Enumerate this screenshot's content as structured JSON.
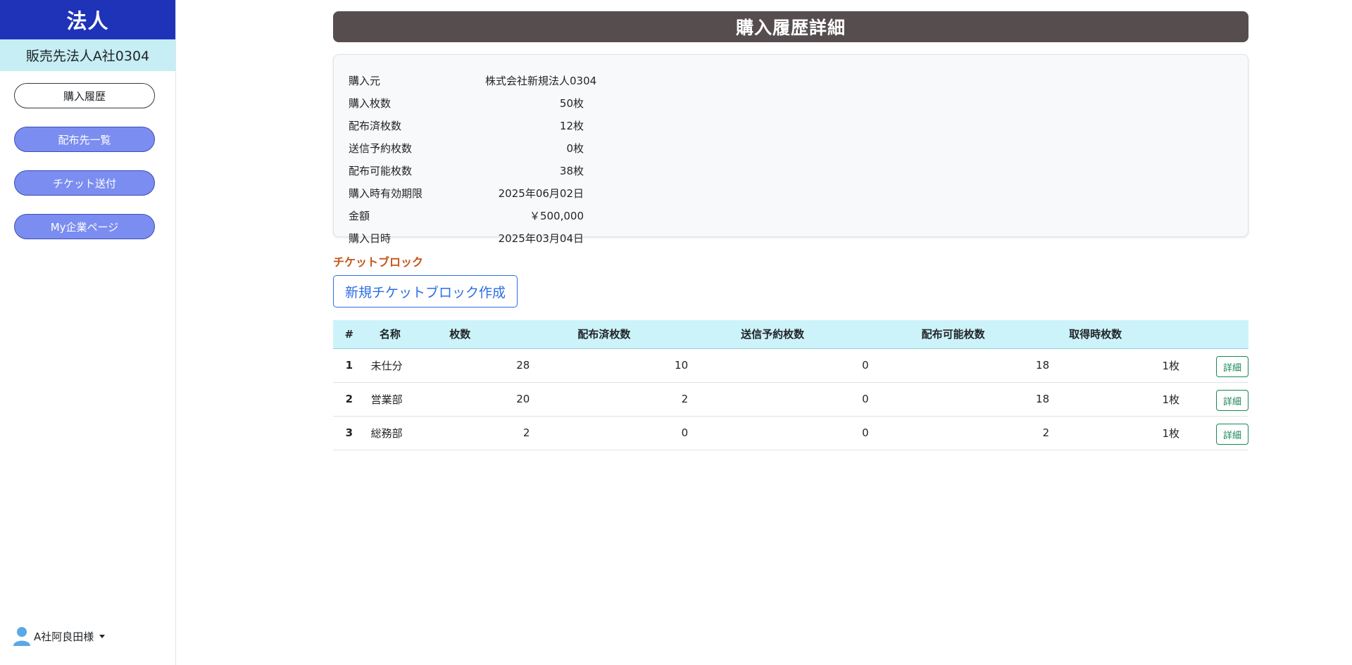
{
  "sidebar": {
    "brand": "法人",
    "company": "販売先法人A社0304",
    "nav": [
      {
        "label": "購入履歴"
      },
      {
        "label": "配布先一覧"
      },
      {
        "label": "チケット送付"
      },
      {
        "label": "My企業ページ"
      }
    ],
    "user": "A社阿良田様"
  },
  "header": {
    "title": "購入履歴詳細"
  },
  "info": [
    {
      "label": "購入元",
      "value": "株式会社新規法人0304"
    },
    {
      "label": "購入枚数",
      "value": "50枚"
    },
    {
      "label": "配布済枚数",
      "value": "12枚"
    },
    {
      "label": "送信予約枚数",
      "value": "0枚"
    },
    {
      "label": "配布可能枚数",
      "value": "38枚"
    },
    {
      "label": "購入時有効期限",
      "value": "2025年06月02日"
    },
    {
      "label": "金額",
      "value": "￥500,000"
    },
    {
      "label": "購入日時",
      "value": "2025年03月04日"
    }
  ],
  "ticket_block": {
    "title": "チケットブロック",
    "new_button": "新規チケットブロック作成",
    "columns": [
      "#",
      "名称",
      "枚数",
      "配布済枚数",
      "送信予約枚数",
      "配布可能枚数",
      "取得時枚数"
    ],
    "rows": [
      {
        "no": "1",
        "name": "未仕分",
        "qty": "28",
        "distributed": "10",
        "reserved": "0",
        "available": "18",
        "acquired": "1枚",
        "action": "詳細"
      },
      {
        "no": "2",
        "name": "営業部",
        "qty": "20",
        "distributed": "2",
        "reserved": "0",
        "available": "18",
        "acquired": "1枚",
        "action": "詳細"
      },
      {
        "no": "3",
        "name": "総務部",
        "qty": "2",
        "distributed": "0",
        "reserved": "0",
        "available": "2",
        "acquired": "1枚",
        "action": "詳細"
      }
    ]
  },
  "colors": {
    "brand_bg": "#1f33b8",
    "company_bg": "#c6eef4",
    "nav_filled": "#7b8df0",
    "header_bg": "#564d4f",
    "section_title": "#c2571a",
    "primary": "#2b6ee6",
    "success": "#198754",
    "table_head_bg": "#cdf3fa"
  }
}
